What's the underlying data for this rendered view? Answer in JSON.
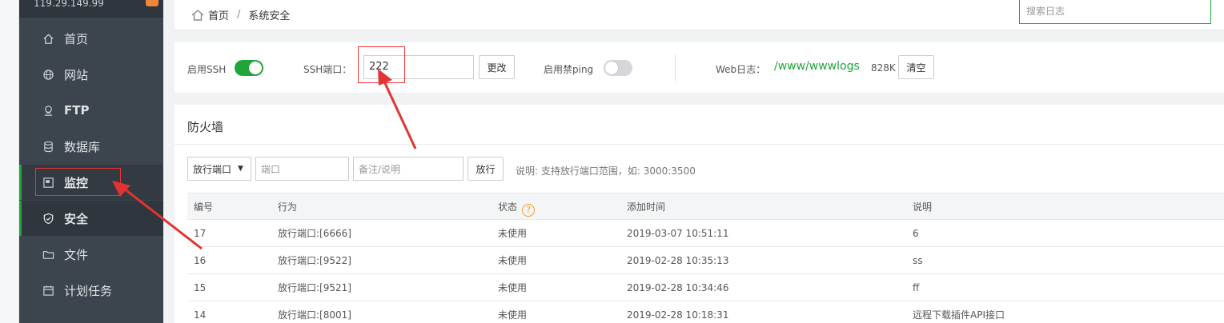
{
  "sidebar": {
    "host": "119.29.149.99",
    "items": [
      {
        "label": "首页",
        "icon": "home-icon"
      },
      {
        "label": "网站",
        "icon": "globe-icon"
      },
      {
        "label": "FTP",
        "icon": "ftp-icon"
      },
      {
        "label": "数据库",
        "icon": "database-icon"
      },
      {
        "label": "监控",
        "icon": "monitor-icon"
      },
      {
        "label": "安全",
        "icon": "shield-icon"
      },
      {
        "label": "文件",
        "icon": "folder-icon"
      },
      {
        "label": "计划任务",
        "icon": "calendar-icon"
      }
    ]
  },
  "breadcrumb": {
    "home": "首页",
    "sep": "/",
    "current": "系统安全"
  },
  "search": {
    "placeholder": "搜索日志"
  },
  "settings": {
    "ssh_label": "启用SSH",
    "ssh_enabled": true,
    "port_label": "SSH端口：",
    "port_value": "222",
    "change_btn": "更改",
    "ping_label": "启用禁ping",
    "ping_enabled": false,
    "weblog_label": "Web日志：",
    "weblog_path": "/www/wwwlogs",
    "weblog_size": "828K",
    "clear_btn": "清空"
  },
  "firewall": {
    "title": "防火墙",
    "select_value": "放行端口",
    "port_placeholder": "端口",
    "note_placeholder": "备注/说明",
    "allow_btn": "放行",
    "hint": "说明: 支持放行端口范围，如: 3000:3500",
    "columns": [
      "编号",
      "行为",
      "状态",
      "添加时间",
      "说明"
    ],
    "rows": [
      {
        "id": "17",
        "action": "放行端口:[6666]",
        "status": "未使用",
        "time": "2019-03-07 10:51:11",
        "note": "6"
      },
      {
        "id": "16",
        "action": "放行端口:[9522]",
        "status": "未使用",
        "time": "2019-02-28 10:35:13",
        "note": "ss"
      },
      {
        "id": "15",
        "action": "放行端口:[9521]",
        "status": "未使用",
        "time": "2019-02-28 10:34:46",
        "note": "ff"
      },
      {
        "id": "14",
        "action": "放行端口:[8001]",
        "status": "未使用",
        "time": "2019-02-28 10:18:31",
        "note": "远程下载插件API接口"
      }
    ]
  },
  "colors": {
    "accent": "#20a53a",
    "sidebar_bg": "#3c444d",
    "annotation": "#e33333"
  }
}
